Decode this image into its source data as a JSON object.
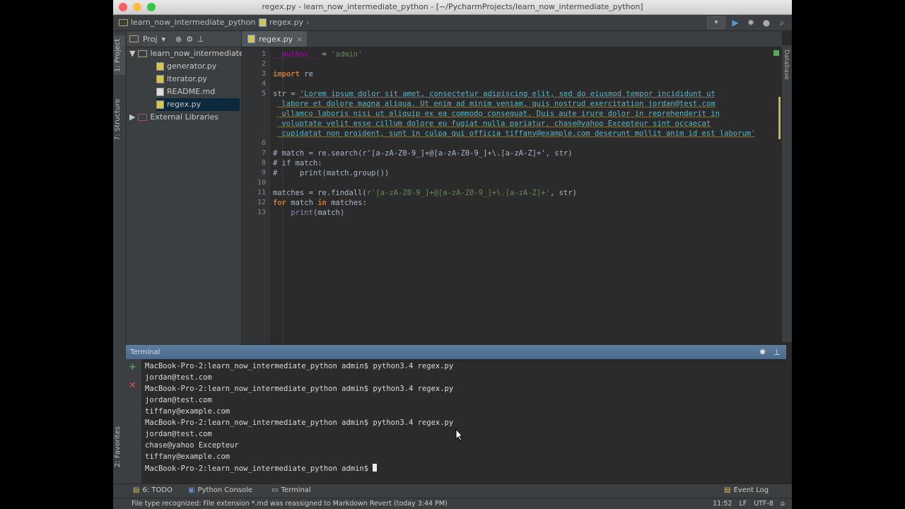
{
  "window": {
    "title": "regex.py - learn_now_intermediate_python - [~/PycharmProjects/learn_now_intermediate_python]"
  },
  "navbar": {
    "project_crumb": "learn_now_intermediate_python",
    "file_crumb": "regex.py"
  },
  "left_strip": {
    "project_tab": "1: Project",
    "structure_tab": "7: Structure",
    "favorites_tab": "2: Favorites"
  },
  "right_strip": {
    "database_tab": "Database"
  },
  "project_panel": {
    "view_label": "Proj",
    "root": "learn_now_intermediate_python",
    "files": [
      "generator.py",
      "iterator.py",
      "README.md",
      "regex.py"
    ],
    "external": "External Libraries"
  },
  "editor": {
    "tab": "regex.py",
    "line_numbers": [
      "1",
      "2",
      "3",
      "4",
      "5",
      "6",
      "7",
      "8",
      "9",
      "10",
      "11",
      "12",
      "13"
    ],
    "code": {
      "l1_name": "__author__",
      "l1_op": " = ",
      "l1_val": "'admin'",
      "l3_kw": "import",
      "l3_rest": " re",
      "l5_var": "str = ",
      "l5_s1": "'Lorem ipsum dolor sit amet, consectetur adipiscing elit, sed do eiusmod tempor incididunt ut",
      "l5_s2": " labore et dolore magna aliqua. Ut enim ad minim veniam, quis nostrud exercitation jordan@test.com",
      "l5_s3": " ullamco laboris nisi ut aliquip ex ea commodo consequat. Duis aute irure dolor in reprehenderit in",
      "l5_s4": " voluptate velit esse cillum dolore eu fugiat nulla pariatur. chase@yahoo Excepteur sint occaecat",
      "l5_s5": " cupidatat non proident, sunt in culpa qui officia tiffany@example.com deserunt mollit anim id est laborum'",
      "l7": "# match = re.search(r'[a-zA-Z0-9_]+@[a-zA-Z0-9_]+\\.[a-zA-Z]+', str)",
      "l8": "# if match:",
      "l9": "#     print(match.group())",
      "l11_a": "matches = re.findall(",
      "l11_s": "r'[a-zA-Z0-9_]+@[a-zA-Z0-9_]+\\.[a-zA-Z]+'",
      "l11_b": ", str)",
      "l12_kw1": "for",
      "l12_m": " match ",
      "l12_kw2": "in",
      "l12_r": " matches:",
      "l13_indent": "    ",
      "l13_fn": "print",
      "l13_r": "(match)"
    }
  },
  "terminal": {
    "title": "Terminal",
    "lines": [
      "MacBook-Pro-2:learn_now_intermediate_python admin$ python3.4 regex.py",
      "jordan@test.com",
      "MacBook-Pro-2:learn_now_intermediate_python admin$ python3.4 regex.py",
      "jordan@test.com",
      "tiffany@example.com",
      "MacBook-Pro-2:learn_now_intermediate_python admin$ python3.4 regex.py",
      "jordan@test.com",
      "chase@yahoo Excepteur",
      "tiffany@example.com"
    ],
    "prompt": "MacBook-Pro-2:learn_now_intermediate_python admin$ "
  },
  "bottom_tabs": {
    "todo": "6: TODO",
    "python_console": "Python Console",
    "terminal": "Terminal",
    "event_log": "Event Log"
  },
  "status": {
    "message": "File type recognized: File extension *.md was reassigned to Markdown Revert (today 3:44 PM)",
    "position": "11:52",
    "line_sep": "LF",
    "encoding": "UTF-8"
  }
}
